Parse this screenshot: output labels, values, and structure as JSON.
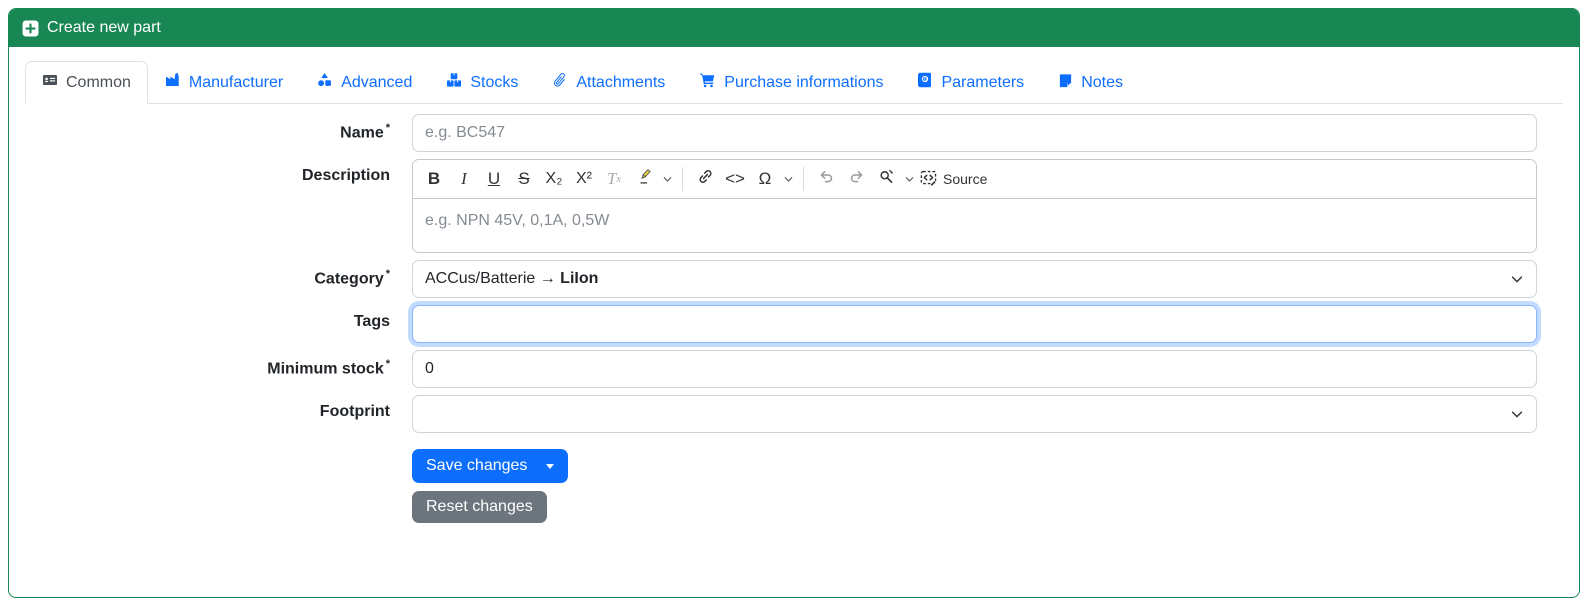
{
  "colors": {
    "accent_green": "#198754",
    "primary_blue": "#0d6efd",
    "secondary_gray": "#6c757d",
    "active_tab_text": "#495057"
  },
  "header": {
    "title": "Create new part"
  },
  "tabs": [
    {
      "label": "Common",
      "icon": "id-card-icon",
      "active": true
    },
    {
      "label": "Manufacturer",
      "icon": "factory-icon",
      "active": false
    },
    {
      "label": "Advanced",
      "icon": "shapes-icon",
      "active": false
    },
    {
      "label": "Stocks",
      "icon": "boxes-stacked-icon",
      "active": false
    },
    {
      "label": "Attachments",
      "icon": "paperclip-icon",
      "active": false
    },
    {
      "label": "Purchase informations",
      "icon": "shopping-cart-icon",
      "active": false
    },
    {
      "label": "Parameters",
      "icon": "book-icon",
      "active": false
    },
    {
      "label": "Notes",
      "icon": "sticky-note-icon",
      "active": false
    }
  ],
  "form": {
    "name": {
      "label": "Name",
      "required": "*",
      "placeholder": "e.g. BC547"
    },
    "description": {
      "label": "Description",
      "placeholder": "e.g. NPN 45V, 0,1A, 0,5W",
      "toolbar": {
        "bold": "B",
        "italic": "I",
        "underline": "U",
        "strikethrough": "S",
        "subscript": "X₂",
        "superscript": "X²",
        "remove_format_t": "T",
        "remove_format_x": "x",
        "code": "<>",
        "special_char": "Ω",
        "source": "Source"
      }
    },
    "category": {
      "label": "Category",
      "required": "*",
      "value_path": "ACCus/Batterie",
      "value_arrow": "→",
      "value_name": "LiIon"
    },
    "tags": {
      "label": "Tags",
      "value": ""
    },
    "minimum_stock": {
      "label": "Minimum stock",
      "required": "*",
      "value": "0"
    },
    "footprint": {
      "label": "Footprint",
      "value": ""
    }
  },
  "buttons": {
    "save": "Save changes",
    "reset": "Reset changes"
  }
}
